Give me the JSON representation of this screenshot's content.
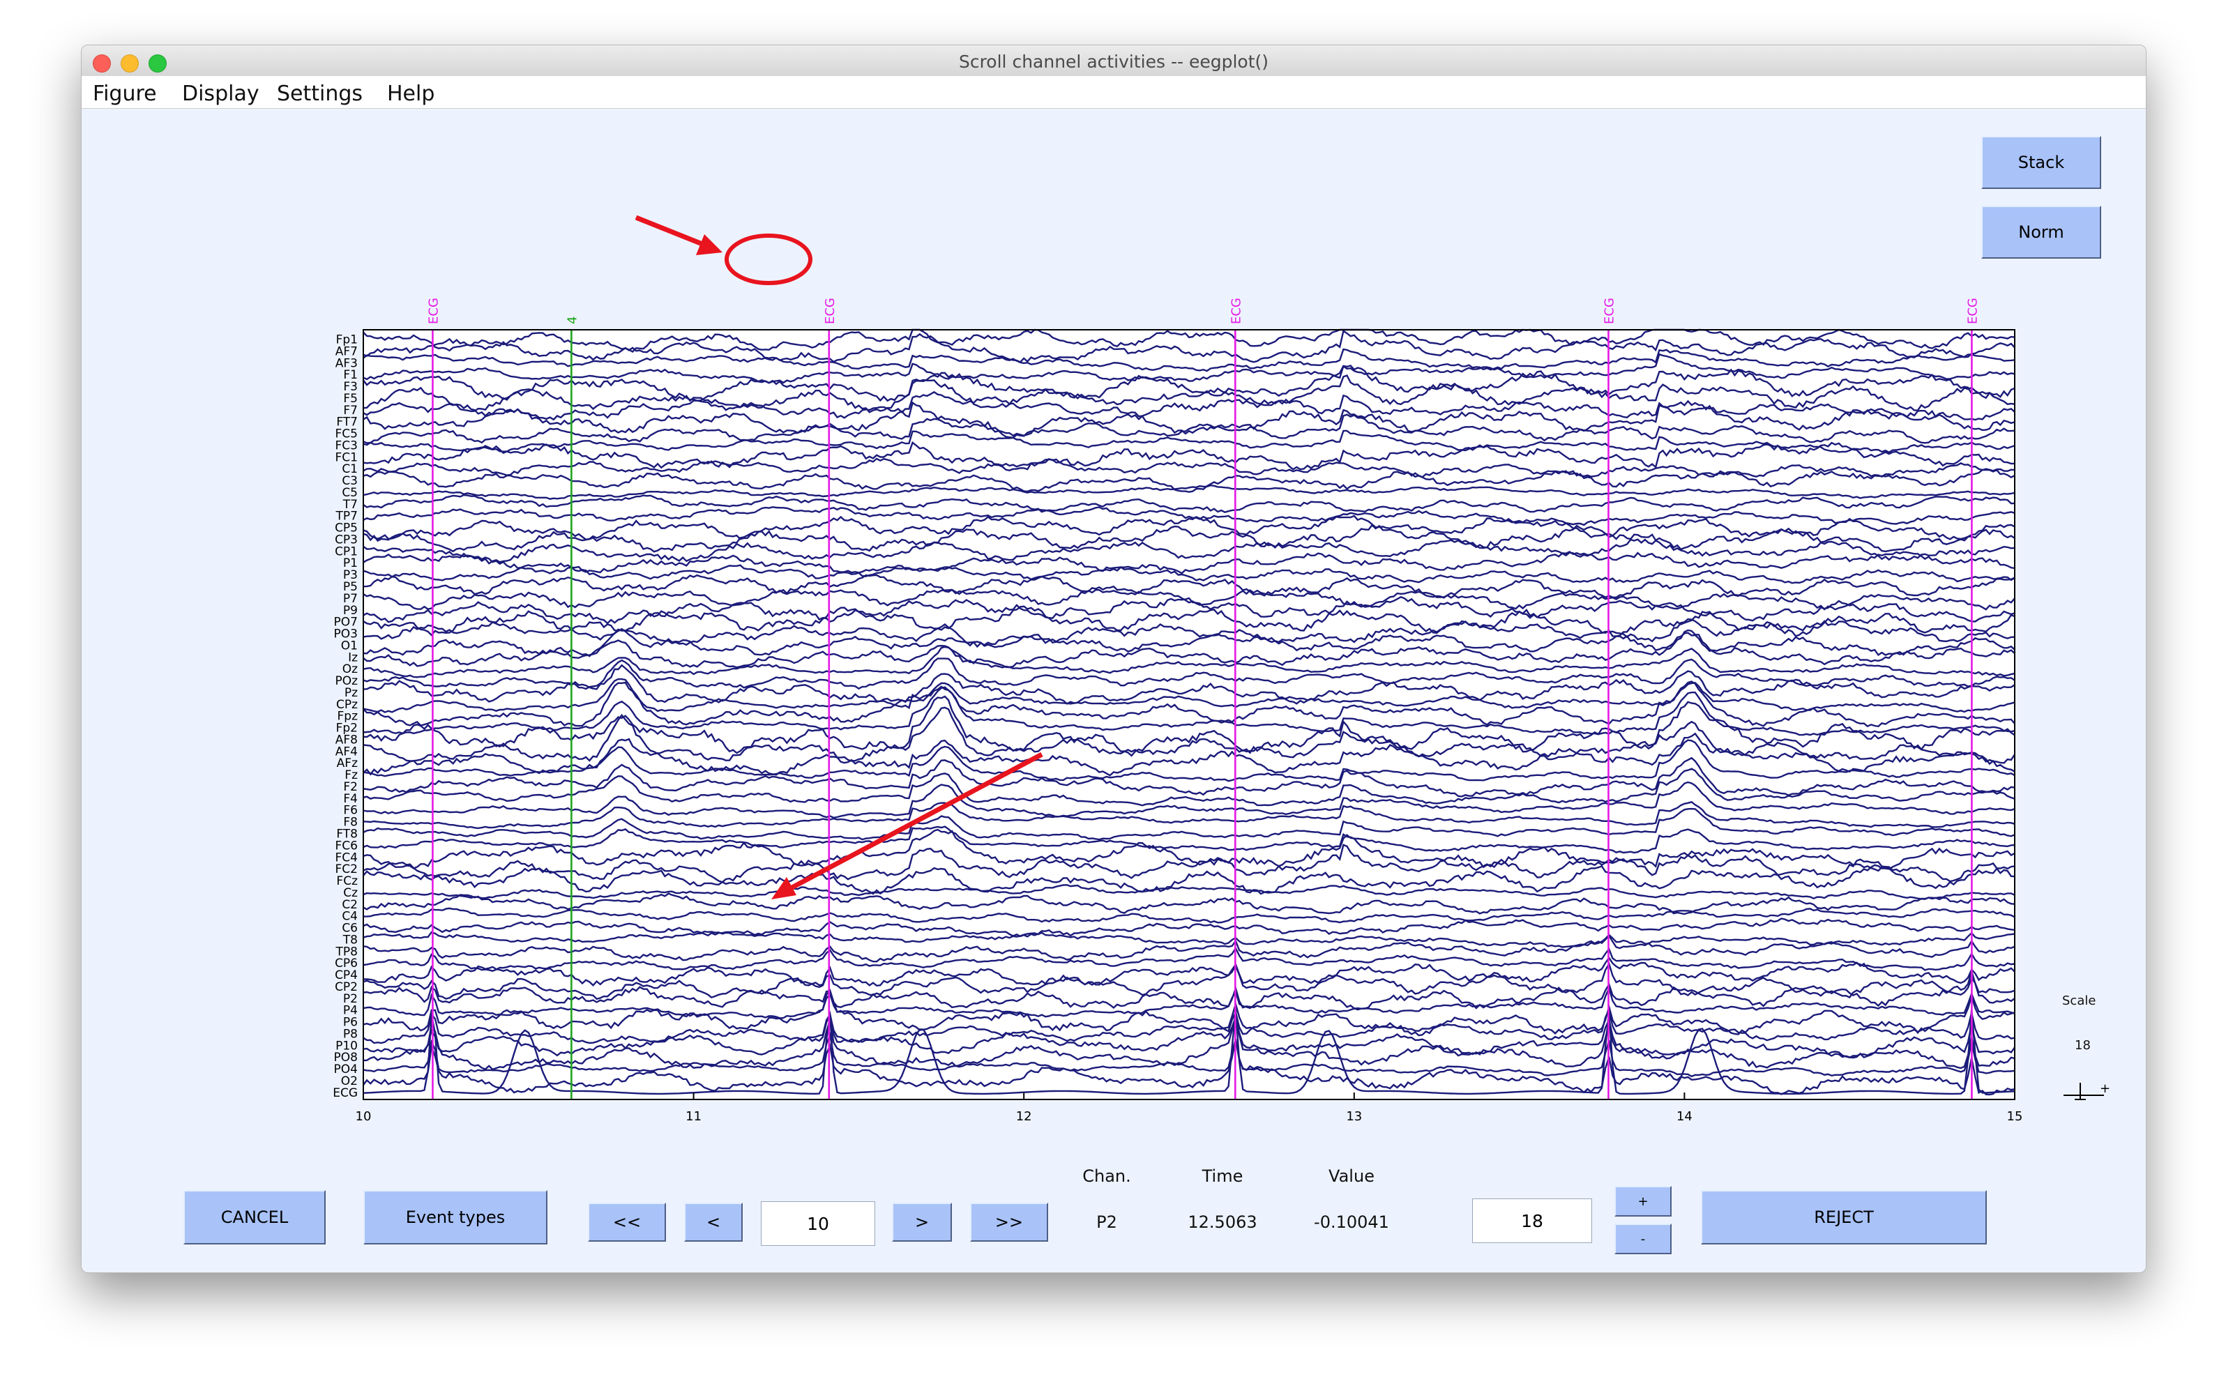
{
  "window": {
    "title": "Scroll channel activities -- eegplot()"
  },
  "menu": [
    "Figure",
    "Display",
    "Settings",
    "Help"
  ],
  "side_buttons": {
    "stack": "Stack",
    "norm": "Norm"
  },
  "channels": [
    "Fp1",
    "AF7",
    "AF3",
    "F1",
    "F3",
    "F5",
    "F7",
    "FT7",
    "FC5",
    "FC3",
    "FC1",
    "C1",
    "C3",
    "C5",
    "T7",
    "TP7",
    "CP5",
    "CP3",
    "CP1",
    "P1",
    "P3",
    "P5",
    "P7",
    "P9",
    "PO7",
    "PO3",
    "O1",
    "Iz",
    "Oz",
    "POz",
    "Pz",
    "CPz",
    "Fpz",
    "Fp2",
    "AF8",
    "AF4",
    "AFz",
    "Fz",
    "F2",
    "F4",
    "F6",
    "F8",
    "FT8",
    "FC6",
    "FC4",
    "FC2",
    "FCz",
    "Cz",
    "C2",
    "C4",
    "C6",
    "T8",
    "TP8",
    "CP6",
    "CP4",
    "CP2",
    "P2",
    "P4",
    "P6",
    "P8",
    "P10",
    "PO8",
    "PO4",
    "O2",
    "ECG"
  ],
  "events": [
    {
      "label": "ECG",
      "time": 10.21,
      "color": "#e619e6"
    },
    {
      "label": "4",
      "time": 10.63,
      "color": "#1fa51f"
    },
    {
      "label": "ECG",
      "time": 11.41,
      "color": "#e619e6"
    },
    {
      "label": "ECG",
      "time": 12.64,
      "color": "#e619e6"
    },
    {
      "label": "ECG",
      "time": 13.77,
      "color": "#e619e6"
    },
    {
      "label": "ECG",
      "time": 14.87,
      "color": "#e619e6"
    }
  ],
  "x_axis": {
    "min": 10,
    "max": 15,
    "ticks": [
      "10",
      "11",
      "12",
      "13",
      "14",
      "15"
    ]
  },
  "scale": {
    "label": "Scale",
    "value": "18"
  },
  "bottom": {
    "cancel": "CANCEL",
    "event_types": "Event types",
    "first": "<<",
    "prev": "<",
    "time_input": "10",
    "next": ">",
    "last": ">>",
    "chan_header": "Chan.",
    "time_header": "Time",
    "value_header": "Value",
    "chan_value": "P2",
    "time_value": "12.5063",
    "value_value": "-0.10041",
    "scale_input": "18",
    "plus": "+",
    "minus": "-",
    "reject": "REJECT"
  },
  "colors": {
    "trace": "#1b1b7a",
    "ecg_event": "#e619e6",
    "event_4": "#1fa51f",
    "annotation": "#e8141e",
    "button": "#a9c3f9",
    "background": "#edf3fe"
  }
}
